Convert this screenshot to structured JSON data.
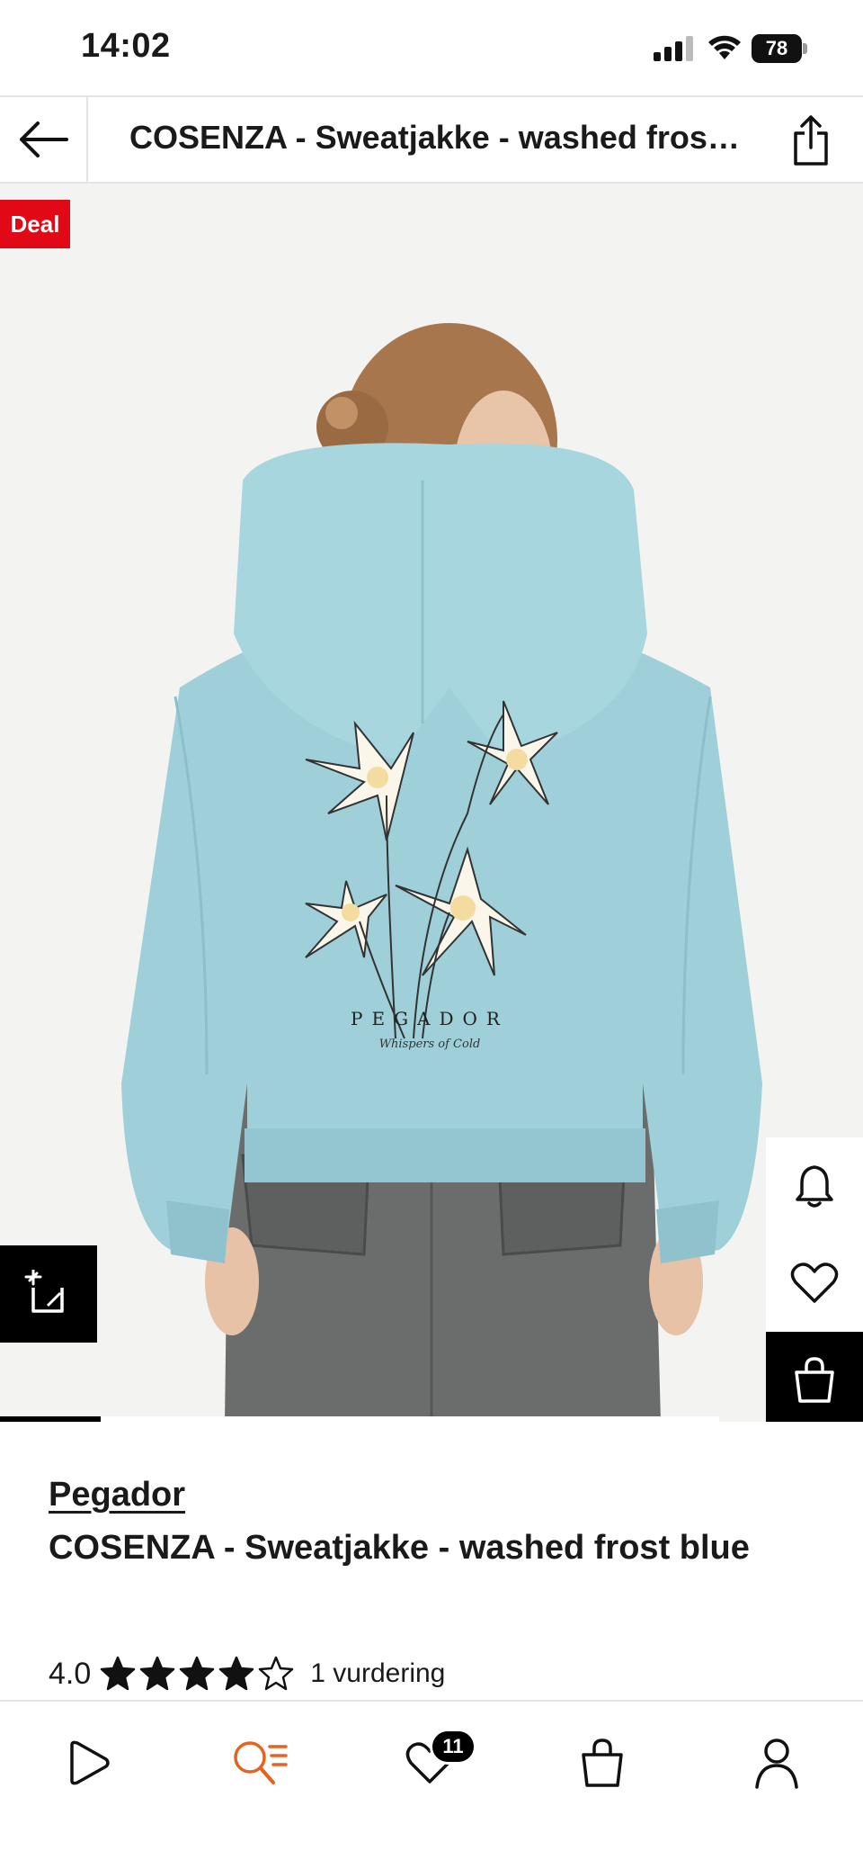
{
  "status_bar": {
    "time": "14:02",
    "battery": "78"
  },
  "header": {
    "title": "COSENZA - Sweatjakke - washed frost blue",
    "back_icon": "arrow-left-icon",
    "share_icon": "share-icon"
  },
  "gallery": {
    "deal_label": "Deal",
    "print_brand": "PEGADOR",
    "print_tagline": "Whispers of Cold",
    "image_position": 1,
    "image_progress_fraction": 0.14
  },
  "side_actions": [
    "bell-icon",
    "heart-icon",
    "shopping-bag-icon"
  ],
  "product": {
    "brand": "Pegador",
    "name": "COSENZA - Sweatjakke - washed frost blue",
    "rating_value": "4.0",
    "stars_filled": 4,
    "stars_total": 5,
    "rating_count_label": "1 vurdering"
  },
  "bottom_nav": {
    "items": [
      {
        "icon": "play-icon",
        "active": false
      },
      {
        "icon": "search-list-icon",
        "active": true
      },
      {
        "icon": "heart-icon",
        "active": false,
        "badge": "11"
      },
      {
        "icon": "shopping-bag-icon",
        "active": false
      },
      {
        "icon": "profile-icon",
        "active": false
      }
    ],
    "active_color": "#e5621f"
  },
  "colors": {
    "deal_red": "#e10916",
    "hoodie_blue": "#9fd0da",
    "accent_orange": "#e5621f"
  }
}
